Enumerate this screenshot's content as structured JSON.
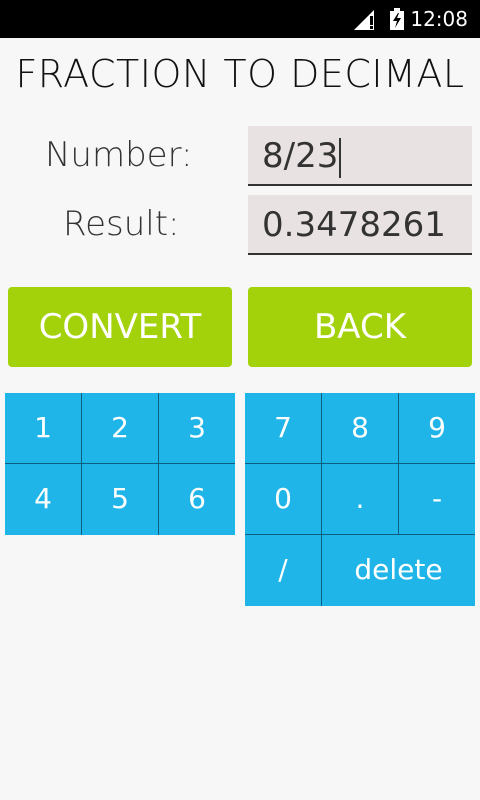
{
  "status_bar": {
    "time": "12:08",
    "icons": [
      "signal-icon",
      "battery-icon"
    ]
  },
  "app": {
    "title": "FRACTION TO DECIMAL"
  },
  "form": {
    "number_label": "Number:",
    "number_value": "8/23",
    "result_label": "Result:",
    "result_value": "0.3478261"
  },
  "buttons": {
    "convert": "CONVERT",
    "back": "BACK"
  },
  "keypad_left": [
    "1",
    "2",
    "3",
    "4",
    "5",
    "6"
  ],
  "keypad_right": [
    "7",
    "8",
    "9",
    "0",
    ".",
    "-",
    "/",
    "delete"
  ],
  "colors": {
    "accent_green": "#a4d20a",
    "keypad_blue": "#1fb5e8",
    "field_bg": "#e9e2e2"
  }
}
